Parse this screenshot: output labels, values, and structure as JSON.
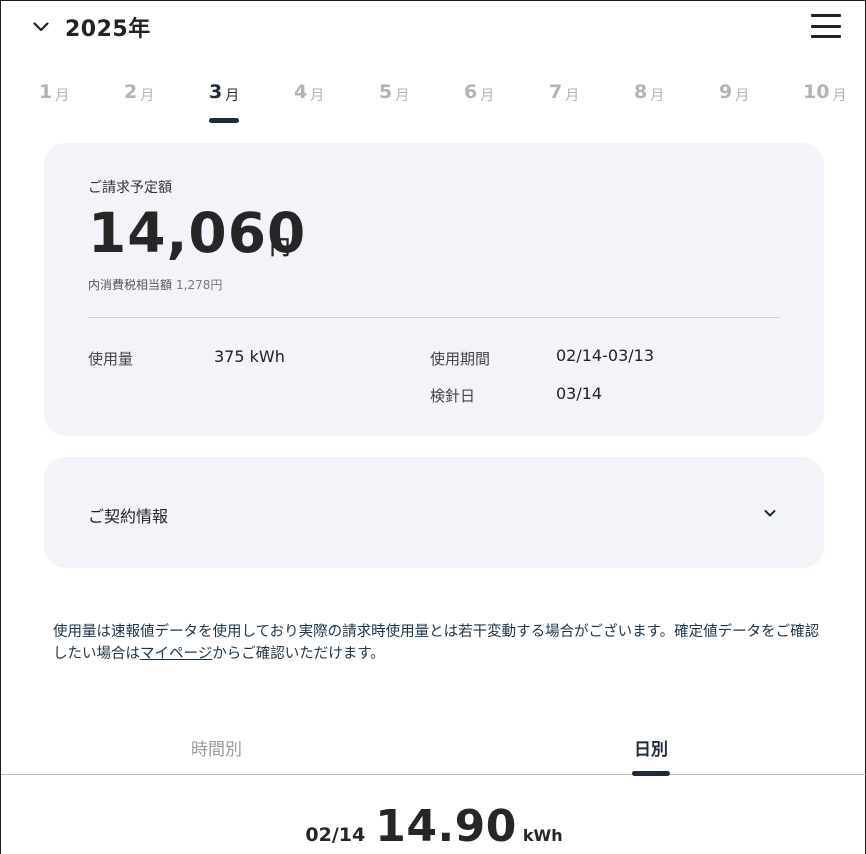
{
  "header": {
    "year_label": "2025年",
    "toggle_icon": "chevron-down-icon",
    "menu_icon": "hamburger-menu-icon"
  },
  "months": [
    {
      "num": "1",
      "unit": "月",
      "active": false
    },
    {
      "num": "2",
      "unit": "月",
      "active": false
    },
    {
      "num": "3",
      "unit": "月",
      "active": true
    },
    {
      "num": "4",
      "unit": "月",
      "active": false
    },
    {
      "num": "5",
      "unit": "月",
      "active": false
    },
    {
      "num": "6",
      "unit": "月",
      "active": false
    },
    {
      "num": "7",
      "unit": "月",
      "active": false
    },
    {
      "num": "8",
      "unit": "月",
      "active": false
    },
    {
      "num": "9",
      "unit": "月",
      "active": false
    },
    {
      "num": "10",
      "unit": "月",
      "active": false
    }
  ],
  "bill": {
    "caption": "ご請求予定額",
    "amount": "14,060",
    "unit": "円",
    "tax_label": "内消費税相当額",
    "tax_value": "1,278円",
    "usage_label": "使用量",
    "usage_value": "375 kWh",
    "period_label": "使用期間",
    "period_value": "02/14-03/13",
    "reading_label": "検針日",
    "reading_value": "03/14"
  },
  "contract": {
    "label": "ご契約情報",
    "icon": "chevron-down-icon"
  },
  "notice": {
    "text_before": "使用量は速報値データを使用しており実際の請求時使用量とは若干変動する場合がございます。確定値データをご確認したい場合は",
    "link_text": "マイページ",
    "text_after": "からご確認いただけます。"
  },
  "view_tabs": {
    "hourly": "時間別",
    "daily": "日別",
    "active": "daily"
  },
  "daily": {
    "date": "02/14",
    "value": "14.90",
    "unit": "kWh"
  },
  "colors": {
    "accent": "#1d2b3a",
    "card_bg": "#f3f4f9",
    "inactive_text": "#b3b3b3",
    "notice_text": "#1c3447"
  }
}
